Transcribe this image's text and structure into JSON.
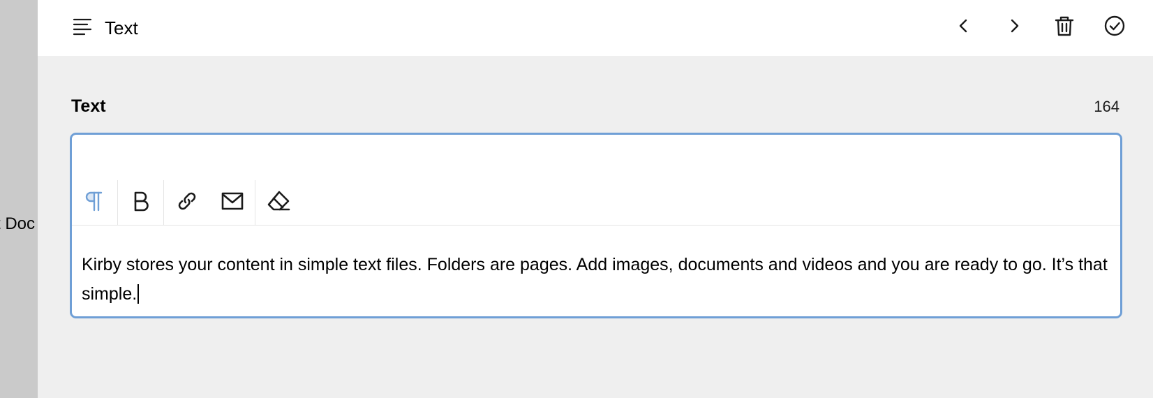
{
  "background": {
    "partial_text": "t Doc"
  },
  "drawer": {
    "title": "Text",
    "actions": [
      {
        "name": "prev-icon"
      },
      {
        "name": "next-icon"
      },
      {
        "name": "trash-icon"
      },
      {
        "name": "check-circle-icon"
      }
    ]
  },
  "field": {
    "label": "Text",
    "counter": "164",
    "toolbar": [
      {
        "name": "paragraph-icon",
        "active": true
      },
      {
        "name": "bold-icon"
      },
      {
        "name": "link-icon"
      },
      {
        "name": "email-icon"
      },
      {
        "name": "clear-format-icon"
      }
    ],
    "content": "Kirby stores your content in simple text files. Folders are pages. Add images, documents and videos and you are ready to go. It’s that simple."
  },
  "colors": {
    "focus_border": "#6f9fd6",
    "active_tool": "#6f9fd6",
    "drawer_background": "#efefef",
    "backdrop": "#cacaca"
  }
}
